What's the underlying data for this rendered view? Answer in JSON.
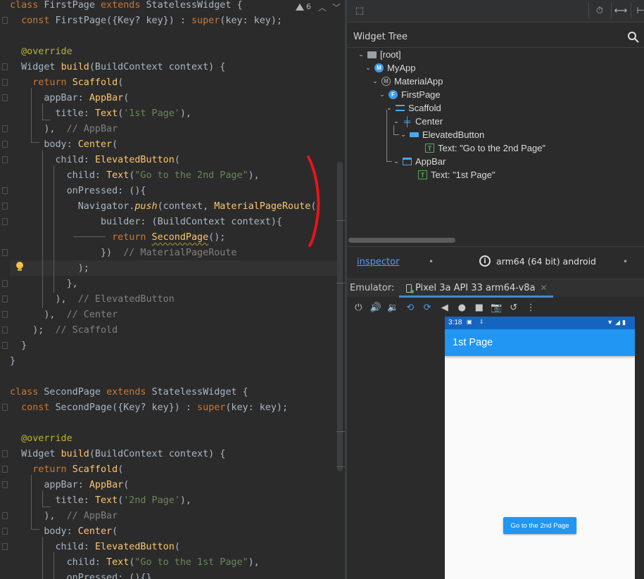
{
  "editor": {
    "warning_count": "6",
    "lines": [
      [
        [
          "kw",
          "class "
        ],
        [
          "",
          "FirstPage "
        ],
        [
          "kw",
          "extends "
        ],
        [
          "",
          "StatelessWidget {"
        ]
      ],
      [
        [
          "",
          "  "
        ],
        [
          "kw",
          "const "
        ],
        [
          "",
          "FirstPage({Key? key}) : "
        ],
        [
          "kw",
          "super"
        ],
        [
          "",
          "(key: key);"
        ]
      ],
      [
        [
          "",
          ""
        ]
      ],
      [
        [
          "ann",
          "  @override"
        ]
      ],
      [
        [
          "",
          "  Widget "
        ],
        [
          "fn",
          "build"
        ],
        [
          "",
          "(BuildContext context) {"
        ]
      ],
      [
        [
          "kw",
          "    return "
        ],
        [
          "cls",
          "Scaffold"
        ],
        [
          "",
          "("
        ]
      ],
      [
        [
          "",
          "      appBar: "
        ],
        [
          "cls",
          "AppBar"
        ],
        [
          "",
          "("
        ]
      ],
      [
        [
          "",
          "        title: "
        ],
        [
          "cls",
          "Text"
        ],
        [
          "",
          "("
        ],
        [
          "str",
          "'1st Page'"
        ],
        [
          "",
          "),"
        ]
      ],
      [
        [
          "",
          "      ),  "
        ],
        [
          "cm",
          "// AppBar"
        ]
      ],
      [
        [
          "",
          "      body: "
        ],
        [
          "cls",
          "Center"
        ],
        [
          "",
          "("
        ]
      ],
      [
        [
          "",
          "        child: "
        ],
        [
          "cls",
          "ElevatedButton"
        ],
        [
          "",
          "("
        ]
      ],
      [
        [
          "",
          "          child: "
        ],
        [
          "cls",
          "Text"
        ],
        [
          "",
          "("
        ],
        [
          "str",
          "\"Go to the 2nd Page\""
        ],
        [
          "",
          "),"
        ]
      ],
      [
        [
          "",
          "          onPressed: (){"
        ]
      ],
      [
        [
          "",
          "            Navigator."
        ],
        [
          "fn it",
          "push"
        ],
        [
          "",
          "(context, "
        ],
        [
          "cls",
          "MaterialPageRoute"
        ],
        [
          "",
          "("
        ]
      ],
      [
        [
          "",
          "                builder: (BuildContext context){"
        ]
      ],
      [
        [
          "kw",
          "                  return "
        ],
        [
          "cls und",
          "SecondPage"
        ],
        [
          "",
          "();"
        ]
      ],
      [
        [
          "",
          "                })  "
        ],
        [
          "cm",
          "// MaterialPageRoute"
        ]
      ],
      [
        [
          "",
          "            );"
        ]
      ],
      [
        [
          "",
          "          },"
        ]
      ],
      [
        [
          "",
          "        ),  "
        ],
        [
          "cm",
          "// ElevatedButton"
        ]
      ],
      [
        [
          "",
          "      ),  "
        ],
        [
          "cm",
          "// Center"
        ]
      ],
      [
        [
          "",
          "    );  "
        ],
        [
          "cm",
          "// Scaffold"
        ]
      ],
      [
        [
          "",
          "  }"
        ]
      ],
      [
        [
          "",
          "}"
        ]
      ],
      [
        [
          "",
          ""
        ]
      ],
      [
        [
          "kw",
          "class "
        ],
        [
          "",
          "SecondPage "
        ],
        [
          "kw",
          "extends "
        ],
        [
          "",
          "StatelessWidget {"
        ]
      ],
      [
        [
          "",
          "  "
        ],
        [
          "kw",
          "const "
        ],
        [
          "",
          "SecondPage({Key? key}) : "
        ],
        [
          "kw",
          "super"
        ],
        [
          "",
          "(key: key);"
        ]
      ],
      [
        [
          "",
          ""
        ]
      ],
      [
        [
          "ann",
          "  @override"
        ]
      ],
      [
        [
          "",
          "  Widget "
        ],
        [
          "fn",
          "build"
        ],
        [
          "",
          "(BuildContext context) {"
        ]
      ],
      [
        [
          "kw",
          "    return "
        ],
        [
          "cls",
          "Scaffold"
        ],
        [
          "",
          "("
        ]
      ],
      [
        [
          "",
          "      appBar: "
        ],
        [
          "cls",
          "AppBar"
        ],
        [
          "",
          "("
        ]
      ],
      [
        [
          "",
          "        title: "
        ],
        [
          "cls",
          "Text"
        ],
        [
          "",
          "("
        ],
        [
          "str",
          "'2nd Page'"
        ],
        [
          "",
          "),"
        ]
      ],
      [
        [
          "",
          "      ),  "
        ],
        [
          "cm",
          "// AppBar"
        ]
      ],
      [
        [
          "",
          "      body: "
        ],
        [
          "cls",
          "Center"
        ],
        [
          "",
          "("
        ]
      ],
      [
        [
          "",
          "        child: "
        ],
        [
          "cls",
          "ElevatedButton"
        ],
        [
          "",
          "("
        ]
      ],
      [
        [
          "",
          "          child: "
        ],
        [
          "cls",
          "Text"
        ],
        [
          "",
          "("
        ],
        [
          "str",
          "\"Go to the 1st Page\""
        ],
        [
          "",
          "),"
        ]
      ],
      [
        [
          "",
          "          onPressed: (){}"
        ]
      ]
    ]
  },
  "inspector": {
    "tree_title": "Widget Tree",
    "nodes": [
      {
        "label": "[root]",
        "icon": "folder-icon",
        "cls": "ic-folder",
        "glyph": ""
      },
      {
        "label": "MyApp",
        "icon": "widget-m-icon",
        "cls": "ic-circle-blue",
        "glyph": "M"
      },
      {
        "label": "MaterialApp",
        "icon": "material-app-icon",
        "cls": "ic-circle-grey",
        "glyph": "M"
      },
      {
        "label": "FirstPage",
        "icon": "widget-f-icon",
        "cls": "ic-circle-blue",
        "glyph": "F"
      },
      {
        "label": "Scaffold",
        "icon": "scaffold-icon",
        "cls": "ic-scaffold",
        "glyph": ""
      },
      {
        "label": "Center",
        "icon": "center-icon",
        "cls": "ic-center",
        "glyph": "╪"
      },
      {
        "label": "ElevatedButton",
        "icon": "button-icon",
        "cls": "ic-button",
        "glyph": ""
      },
      {
        "label": "Text: \"Go to the 2nd Page\"",
        "icon": "text-icon",
        "cls": "ic-text",
        "glyph": "T"
      },
      {
        "label": "AppBar",
        "icon": "appbar-icon",
        "cls": "ic-appbar",
        "glyph": ""
      },
      {
        "label": "Text: \"1st Page\"",
        "icon": "text-icon",
        "cls": "ic-text",
        "glyph": "T"
      }
    ],
    "link": "inspector",
    "device": "arm64 (64 bit) android"
  },
  "emulator": {
    "label": "Emulator:",
    "tab": "Pixel 3a API 33 arm64-v8a",
    "controls": [
      {
        "name": "power-icon",
        "glyph": "⏻",
        "blue": false
      },
      {
        "name": "volume-up-icon",
        "glyph": "🔊",
        "blue": false
      },
      {
        "name": "volume-down-icon",
        "glyph": "🔉",
        "blue": false
      },
      {
        "name": "rotate-left-icon",
        "glyph": "⟲",
        "blue": true
      },
      {
        "name": "rotate-right-icon",
        "glyph": "⟳",
        "blue": true
      },
      {
        "name": "back-icon",
        "glyph": "◀",
        "blue": false
      },
      {
        "name": "home-icon",
        "glyph": "●",
        "blue": false
      },
      {
        "name": "overview-icon",
        "glyph": "■",
        "blue": false
      },
      {
        "name": "camera-icon",
        "glyph": "📷",
        "blue": false
      },
      {
        "name": "snapshot-icon",
        "glyph": "↺",
        "blue": false
      },
      {
        "name": "more-icon",
        "glyph": "⋮",
        "blue": false
      }
    ]
  },
  "phone": {
    "time": "3:18",
    "title": "1st Page",
    "button": "Go to the 2nd Page"
  }
}
